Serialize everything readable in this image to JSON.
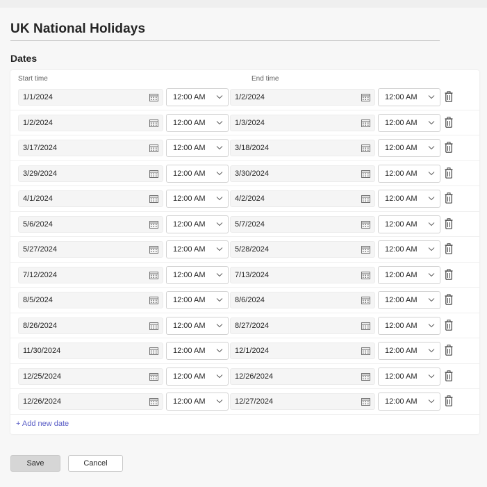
{
  "page": {
    "title": "UK National Holidays"
  },
  "section": {
    "title": "Dates"
  },
  "columns": {
    "start": "Start time",
    "end": "End time"
  },
  "dates": [
    {
      "start_date": "1/1/2024",
      "start_time": "12:00 AM",
      "end_date": "1/2/2024",
      "end_time": "12:00 AM"
    },
    {
      "start_date": "1/2/2024",
      "start_time": "12:00 AM",
      "end_date": "1/3/2024",
      "end_time": "12:00 AM"
    },
    {
      "start_date": "3/17/2024",
      "start_time": "12:00 AM",
      "end_date": "3/18/2024",
      "end_time": "12:00 AM"
    },
    {
      "start_date": "3/29/2024",
      "start_time": "12:00 AM",
      "end_date": "3/30/2024",
      "end_time": "12:00 AM"
    },
    {
      "start_date": "4/1/2024",
      "start_time": "12:00 AM",
      "end_date": "4/2/2024",
      "end_time": "12:00 AM"
    },
    {
      "start_date": "5/6/2024",
      "start_time": "12:00 AM",
      "end_date": "5/7/2024",
      "end_time": "12:00 AM"
    },
    {
      "start_date": "5/27/2024",
      "start_time": "12:00 AM",
      "end_date": "5/28/2024",
      "end_time": "12:00 AM"
    },
    {
      "start_date": "7/12/2024",
      "start_time": "12:00 AM",
      "end_date": "7/13/2024",
      "end_time": "12:00 AM"
    },
    {
      "start_date": "8/5/2024",
      "start_time": "12:00 AM",
      "end_date": "8/6/2024",
      "end_time": "12:00 AM"
    },
    {
      "start_date": "8/26/2024",
      "start_time": "12:00 AM",
      "end_date": "8/27/2024",
      "end_time": "12:00 AM"
    },
    {
      "start_date": "11/30/2024",
      "start_time": "12:00 AM",
      "end_date": "12/1/2024",
      "end_time": "12:00 AM"
    },
    {
      "start_date": "12/25/2024",
      "start_time": "12:00 AM",
      "end_date": "12/26/2024",
      "end_time": "12:00 AM"
    },
    {
      "start_date": "12/26/2024",
      "start_time": "12:00 AM",
      "end_date": "12/27/2024",
      "end_time": "12:00 AM"
    }
  ],
  "add_date_label": "+ Add new date",
  "buttons": {
    "save": "Save",
    "cancel": "Cancel"
  },
  "icons": {
    "calendar": "calendar-icon",
    "dropdown": "chevron-down-icon",
    "delete": "trash-icon"
  },
  "colors": {
    "link": "#5b5fc7",
    "save_disabled": "#d6d6d6"
  }
}
